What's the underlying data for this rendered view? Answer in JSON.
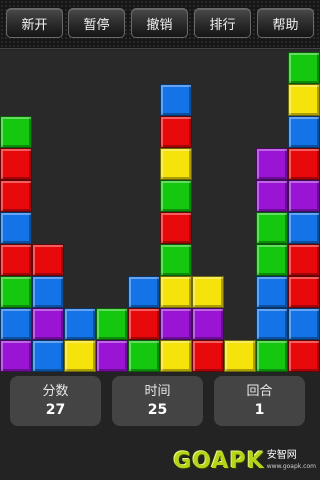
{
  "toolbar": {
    "buttons": [
      {
        "id": "new",
        "label": "新开"
      },
      {
        "id": "pause",
        "label": "暂停"
      },
      {
        "id": "undo",
        "label": "撤销"
      },
      {
        "id": "rank",
        "label": "排行"
      },
      {
        "id": "help",
        "label": "帮助"
      }
    ]
  },
  "board": {
    "cols": 10,
    "rows": 10,
    "colors": {
      "G": "#14c80f",
      "R": "#e8090c",
      "B": "#1473e6",
      "Y": "#f5e30b",
      "P": "#9a14d6"
    },
    "grid": [
      ".........G",
      ".....B...Y",
      "G....R...B",
      "R....Y..PR",
      "R....G..PP",
      "B....R..GB",
      "RR...G..GR",
      "GB..BYY.BR",
      "BPBGRPP.BB",
      "PBYPGYRYGR"
    ]
  },
  "stats": {
    "score": {
      "label": "分数",
      "value": "27"
    },
    "time": {
      "label": "时间",
      "value": "25"
    },
    "round": {
      "label": "回合",
      "value": "1"
    }
  },
  "watermark": {
    "brand": "GOAPK",
    "cn": "安智网",
    "url": "www.goapk.com"
  }
}
